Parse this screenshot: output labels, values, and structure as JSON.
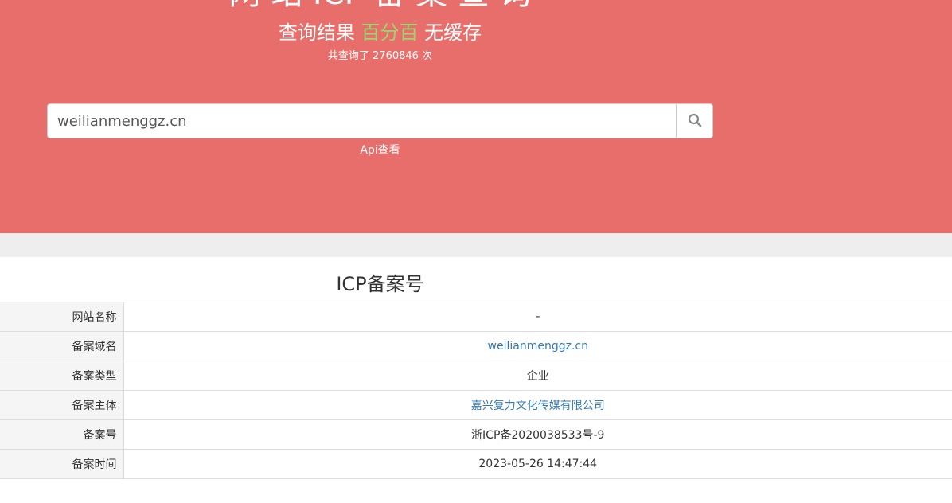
{
  "hero": {
    "title": "网 站 ICP 备 案 查 询",
    "subtitle_prefix": "查询结果",
    "subtitle_highlight": "百分百",
    "subtitle_suffix": "无缓存",
    "query_count": "共查询了 2760846 次",
    "highlight_color": "#9bd56f",
    "background_color": "#e86e6b"
  },
  "search": {
    "value": "weilianmenggz.cn",
    "button_icon": "search-icon"
  },
  "api_link": "Api查看",
  "result": {
    "title": "ICP备案号",
    "rows": [
      {
        "label": "网站名称",
        "value": "-",
        "link": false
      },
      {
        "label": "备案域名",
        "value": "weilianmenggz.cn",
        "link": true
      },
      {
        "label": "备案类型",
        "value": "企业",
        "link": false
      },
      {
        "label": "备案主体",
        "value": "嘉兴复力文化传媒有限公司",
        "link": true
      },
      {
        "label": "备案号",
        "value": "浙ICP备2020038533号-9",
        "link": false
      },
      {
        "label": "备案时间",
        "value": "2023-05-26 14:47:44",
        "link": false
      }
    ],
    "link_color": "#337ab7"
  }
}
